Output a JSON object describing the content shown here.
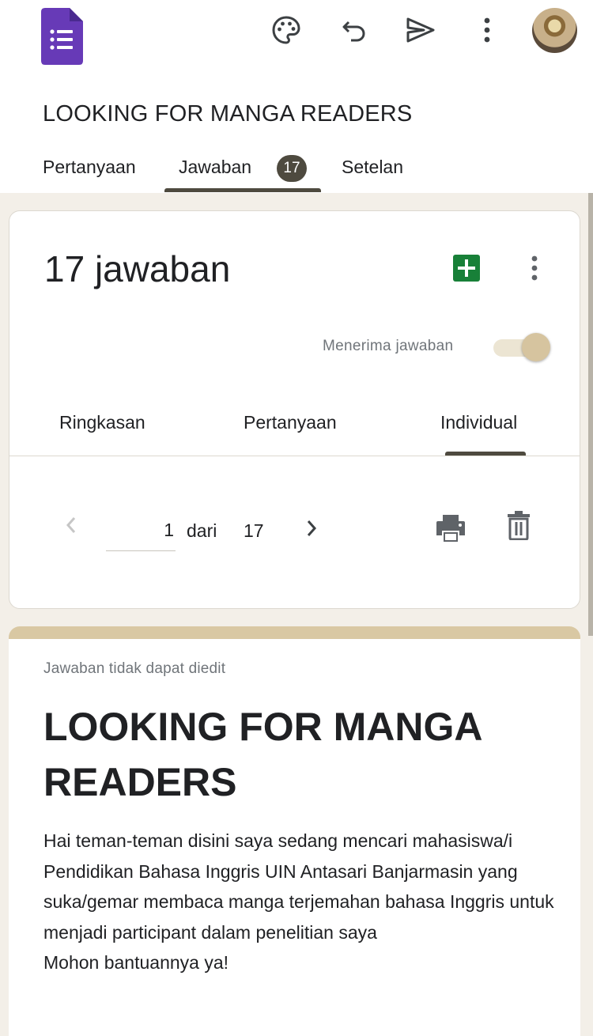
{
  "header": {
    "app_icon": "google-forms-icon",
    "actions": [
      {
        "icon": "palette-icon"
      },
      {
        "icon": "undo-icon"
      },
      {
        "icon": "send-icon"
      },
      {
        "icon": "more-vert-icon"
      }
    ],
    "avatar": "user-avatar"
  },
  "form": {
    "title": "LOOKING FOR MANGA READERS"
  },
  "tabs": {
    "questions": "Pertanyaan",
    "responses": "Jawaban",
    "responses_count": "17",
    "settings": "Setelan",
    "active": "responses"
  },
  "summary_card": {
    "count_title": "17 jawaban",
    "accepting_label": "Menerima jawaban",
    "accepting_on": true,
    "subtabs": {
      "summary": "Ringkasan",
      "question": "Pertanyaan",
      "individual": "Individual",
      "active": "individual"
    },
    "pager": {
      "current": "1",
      "of_label": "dari",
      "total": "17"
    }
  },
  "response_card": {
    "notice": "Jawaban tidak dapat diedit",
    "title": "LOOKING FOR MANGA READERS",
    "description": "Hai teman-teman disini saya sedang mencari mahasiswa/i Pendidikan Bahasa Inggris UIN Antasari Banjarmasin yang suka/gemar membaca manga terjemahan bahasa Inggris untuk menjadi participant dalam penelitian saya\nMohon bantuannya ya!"
  },
  "colors": {
    "forms_purple": "#673ab7",
    "accent_dark": "#4e4a3f",
    "sheets_green": "#188038",
    "theme_tan": "#d9c8a3",
    "background": "#f3efe8"
  }
}
